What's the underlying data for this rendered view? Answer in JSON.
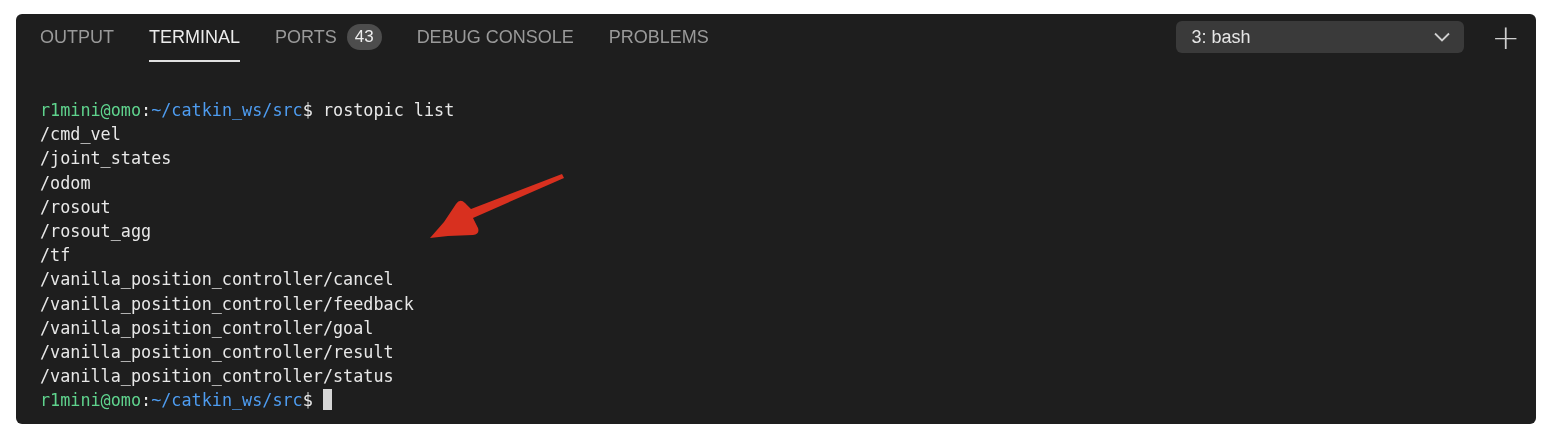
{
  "tabs": [
    {
      "label": "OUTPUT",
      "selected": false
    },
    {
      "label": "TERMINAL",
      "selected": true
    },
    {
      "label": "PORTS",
      "selected": false,
      "badge": "43"
    },
    {
      "label": "DEBUG CONSOLE",
      "selected": false
    },
    {
      "label": "PROBLEMS",
      "selected": false
    }
  ],
  "terminal_selector": {
    "value": "3: bash"
  },
  "new_terminal_button": {
    "label": "+"
  },
  "terminal_lines": [
    {
      "kind": "prompt",
      "user": "r1mini@omo",
      "separator": ":",
      "path": "~/catkin_ws/src",
      "symbol": "$",
      "command": "rostopic list",
      "cursor": false
    },
    {
      "kind": "output",
      "text": "/cmd_vel"
    },
    {
      "kind": "output",
      "text": "/joint_states"
    },
    {
      "kind": "output",
      "text": "/odom"
    },
    {
      "kind": "output",
      "text": "/rosout"
    },
    {
      "kind": "output",
      "text": "/rosout_agg"
    },
    {
      "kind": "output",
      "text": "/tf"
    },
    {
      "kind": "output",
      "text": "/vanilla_position_controller/cancel"
    },
    {
      "kind": "output",
      "text": "/vanilla_position_controller/feedback"
    },
    {
      "kind": "output",
      "text": "/vanilla_position_controller/goal"
    },
    {
      "kind": "output",
      "text": "/vanilla_position_controller/result"
    },
    {
      "kind": "output",
      "text": "/vanilla_position_controller/status"
    },
    {
      "kind": "prompt",
      "user": "r1mini@omo",
      "separator": ":",
      "path": "~/catkin_ws/src",
      "symbol": "$",
      "cursor": true
    }
  ]
}
